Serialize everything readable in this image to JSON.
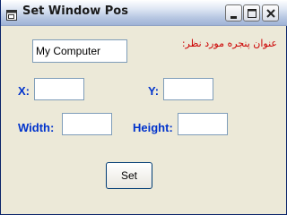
{
  "window": {
    "title": "Set Window Pos",
    "icons": {
      "app": "window-icon",
      "minimize": "minimize-icon",
      "maximize": "maximize-icon",
      "close": "close-icon"
    }
  },
  "form": {
    "window_title_label": "عنوان پنجره مورد نظر:",
    "window_title_value": "My Computer",
    "x_label": "X:",
    "x_value": "",
    "y_label": "Y:",
    "y_value": "",
    "width_label": "Width:",
    "width_value": "",
    "height_label": "Height:",
    "height_value": "",
    "set_button_label": "Set"
  },
  "colors": {
    "label_blue": "#0033cc",
    "label_red": "#cc0000",
    "dialog_bg": "#ece9d8"
  }
}
